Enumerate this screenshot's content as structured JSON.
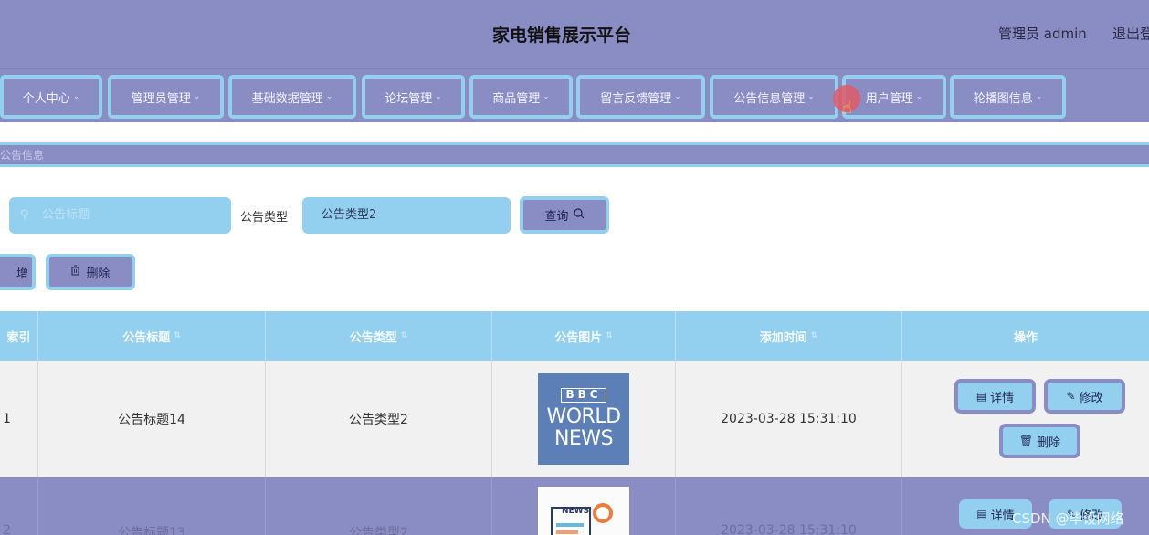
{
  "header": {
    "title": "家电销售展示平台",
    "user": "管理员 admin",
    "logout": "退出登"
  },
  "nav": {
    "items": [
      {
        "label": "个人中心"
      },
      {
        "label": "管理员管理"
      },
      {
        "label": "基础数据管理"
      },
      {
        "label": "论坛管理"
      },
      {
        "label": "商品管理"
      },
      {
        "label": "留言反馈管理"
      },
      {
        "label": "公告信息管理"
      },
      {
        "label": "用户管理"
      },
      {
        "label": "轮播图信息"
      }
    ],
    "chevron": "⌄"
  },
  "breadcrumb": {
    "label": "公告信息"
  },
  "search": {
    "title_placeholder": "公告标题",
    "type_label": "公告类型",
    "type_value": "公告类型2",
    "query_label": "查询"
  },
  "actions": {
    "add_label": "增",
    "delete_label": "删除"
  },
  "table": {
    "columns": [
      "索引",
      "公告标题",
      "公告类型",
      "公告图片",
      "添加时间",
      "操作"
    ],
    "rows": [
      {
        "index": "1",
        "title": "公告标题14",
        "type": "公告类型2",
        "image_text": [
          "BBC",
          "WORLD",
          "NEWS"
        ],
        "time": "2023-03-28 15:31:10"
      },
      {
        "index": "2",
        "title": "公告标题13",
        "type": "公告类型2",
        "image_text": [
          "NEWS"
        ],
        "time": "2023-03-28 15:31:10"
      }
    ],
    "op_labels": {
      "detail": "详情",
      "edit": "修改",
      "delete": "删除"
    }
  },
  "watermark": "CSDN @毕设网络",
  "colors": {
    "primary": "#8a8cc4",
    "accent": "#93d0ef",
    "row_bg": "#f1f1f1"
  }
}
